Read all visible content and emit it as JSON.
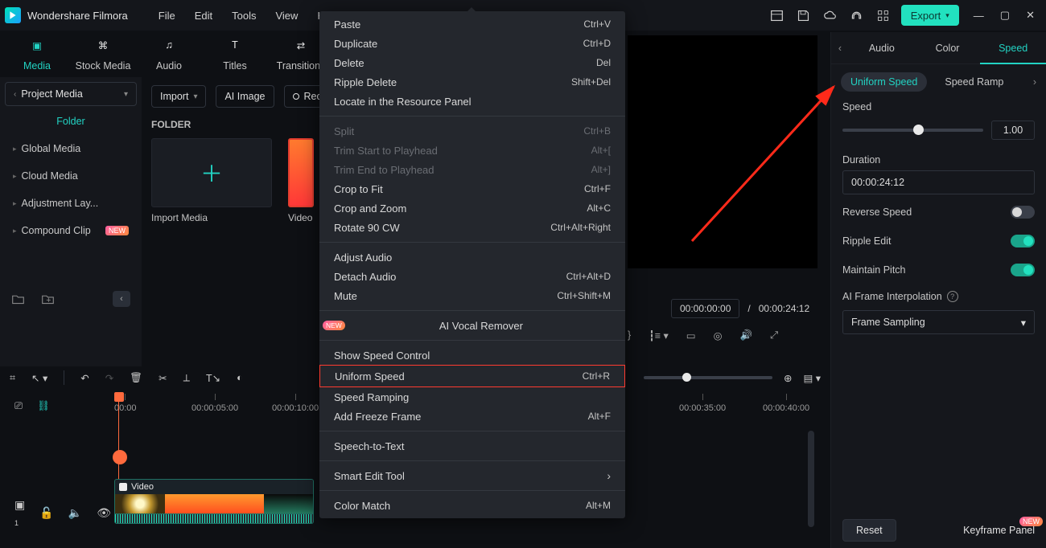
{
  "app": {
    "title": "Wondershare Filmora"
  },
  "menubar": {
    "file": "File",
    "edit": "Edit",
    "tools": "Tools",
    "view": "View",
    "help": "He"
  },
  "export_btn": "Export",
  "mode_tabs": {
    "media": "Media",
    "stock": "Stock Media",
    "audio": "Audio",
    "titles": "Titles",
    "transitions": "Transitions"
  },
  "left": {
    "project_media": "Project Media",
    "folder_label": "Folder",
    "items": {
      "global": "Global Media",
      "cloud": "Cloud Media",
      "adjustment": "Adjustment Lay...",
      "compound": "Compound Clip"
    }
  },
  "toolbar": {
    "import": "Import",
    "ai_image": "AI Image",
    "record": "Rec"
  },
  "folder_heading": "FOLDER",
  "tiles": {
    "import_media": "Import Media",
    "video": "Video"
  },
  "preview": {
    "cur": "00:00:00:00",
    "sep": "/",
    "total": "00:00:24:12"
  },
  "ruler": {
    "t0": "00:00",
    "t5": "00:00:05:00",
    "t10": "00:00:10:00",
    "t35": "00:00:35:00",
    "t40": "00:00:40:00"
  },
  "clip": {
    "label": "Video"
  },
  "inspector": {
    "tabs": {
      "audio": "Audio",
      "color": "Color",
      "speed": "Speed"
    },
    "sub": {
      "uniform": "Uniform Speed",
      "ramp": "Speed Ramp"
    },
    "speed_label": "Speed",
    "speed_value": "1.00",
    "duration_label": "Duration",
    "duration_value": "00:00:24:12",
    "reverse": "Reverse Speed",
    "ripple": "Ripple Edit",
    "pitch": "Maintain Pitch",
    "ai_interp": "AI Frame Interpolation",
    "frame_sampling": "Frame Sampling",
    "reset": "Reset",
    "keyframe": "Keyframe Panel",
    "new_badge": "NEW"
  },
  "context_menu": {
    "paste": {
      "label": "Paste",
      "sc": "Ctrl+V"
    },
    "duplicate": {
      "label": "Duplicate",
      "sc": "Ctrl+D"
    },
    "delete": {
      "label": "Delete",
      "sc": "Del"
    },
    "ripple_delete": {
      "label": "Ripple Delete",
      "sc": "Shift+Del"
    },
    "locate": {
      "label": "Locate in the Resource Panel"
    },
    "split": {
      "label": "Split",
      "sc": "Ctrl+B"
    },
    "trim_start": {
      "label": "Trim Start to Playhead",
      "sc": "Alt+["
    },
    "trim_end": {
      "label": "Trim End to Playhead",
      "sc": "Alt+]"
    },
    "crop_fit": {
      "label": "Crop to Fit",
      "sc": "Ctrl+F"
    },
    "crop_zoom": {
      "label": "Crop and Zoom",
      "sc": "Alt+C"
    },
    "rotate": {
      "label": "Rotate 90 CW",
      "sc": "Ctrl+Alt+Right"
    },
    "adjust_audio": {
      "label": "Adjust Audio"
    },
    "detach_audio": {
      "label": "Detach Audio",
      "sc": "Ctrl+Alt+D"
    },
    "mute": {
      "label": "Mute",
      "sc": "Ctrl+Shift+M"
    },
    "ai_vocal": {
      "label": "AI Vocal Remover"
    },
    "show_speed": {
      "label": "Show Speed Control"
    },
    "uniform_speed": {
      "label": "Uniform Speed",
      "sc": "Ctrl+R"
    },
    "speed_ramping": {
      "label": "Speed Ramping"
    },
    "freeze": {
      "label": "Add Freeze Frame",
      "sc": "Alt+F"
    },
    "stt": {
      "label": "Speech-to-Text"
    },
    "smart_edit": {
      "label": "Smart Edit Tool"
    },
    "color_match": {
      "label": "Color Match",
      "sc": "Alt+M"
    }
  }
}
